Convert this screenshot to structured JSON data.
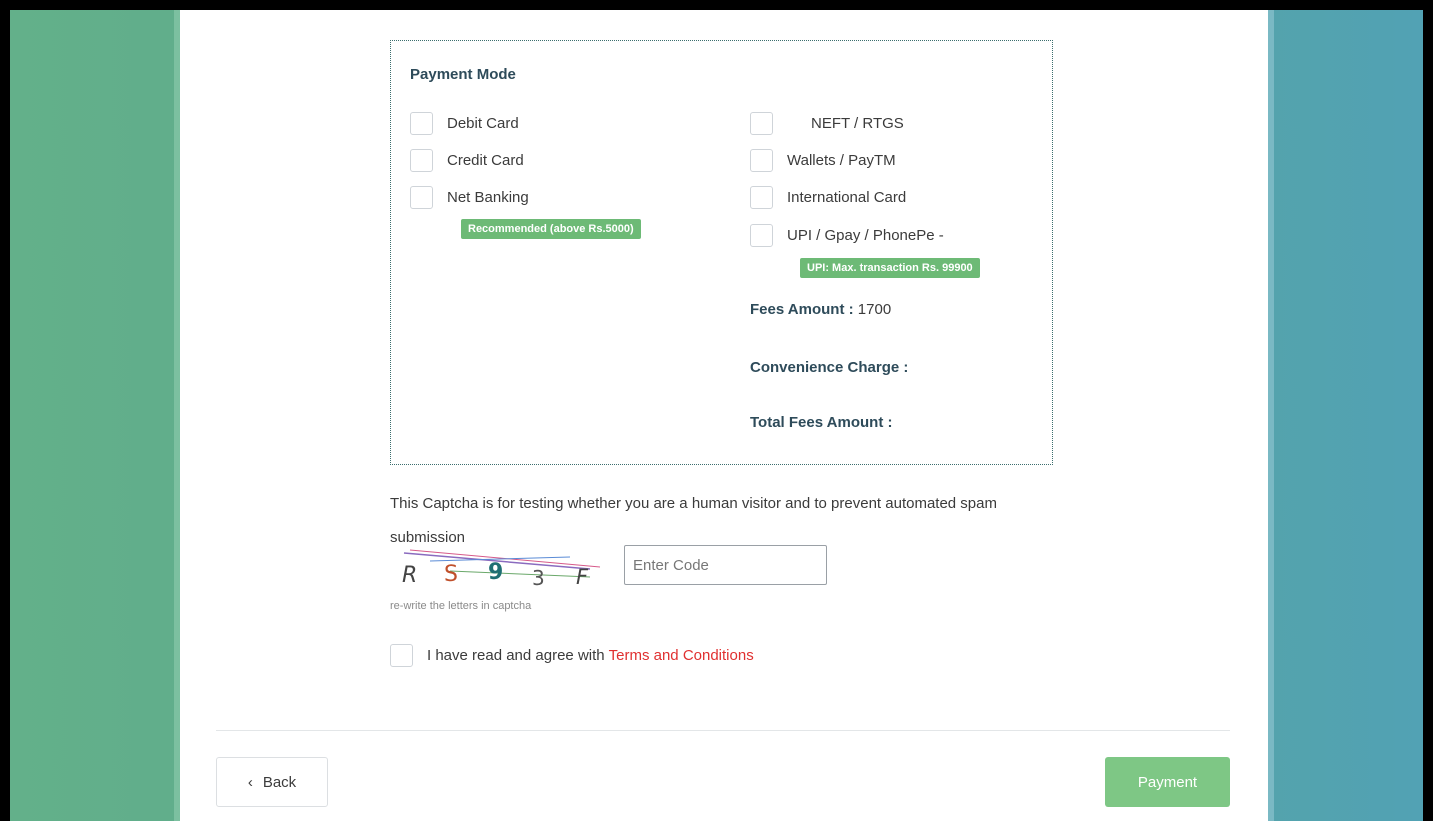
{
  "payment_mode": {
    "title": "Payment Mode",
    "left_options": [
      {
        "label": "Debit Card",
        "checked": false
      },
      {
        "label": "Credit Card",
        "checked": false
      },
      {
        "label": "Net Banking",
        "checked": false
      }
    ],
    "right_options": [
      {
        "label": "NEFT / RTGS",
        "checked": false
      },
      {
        "label": "Wallets / PayTM",
        "checked": false
      },
      {
        "label": "International Card",
        "checked": false
      },
      {
        "label": "UPI / Gpay / PhonePe -",
        "checked": false
      }
    ],
    "net_banking_badge": "Recommended (above Rs.5000)",
    "upi_badge": "UPI: Max. transaction Rs. 99900"
  },
  "fees": {
    "fees_amount_label": "Fees Amount :",
    "fees_amount_value": " 1700",
    "convenience_label": "Convenience Charge :",
    "convenience_value": "",
    "total_label": "Total Fees Amount :",
    "total_value": ""
  },
  "captcha": {
    "description": "This Captcha is for testing whether you are a human visitor and to prevent automated spam submission",
    "letters": [
      "R",
      "S",
      "9",
      "3",
      "F"
    ],
    "input_placeholder": "Enter Code",
    "input_value": "",
    "hint": "re-write the letters in captcha"
  },
  "agreement": {
    "text": "I have read and agree with",
    "link": "Terms and Conditions",
    "checked": false
  },
  "footer": {
    "back_icon": "chevron-left-icon",
    "back_label": "Back",
    "payment_label": "Payment"
  },
  "colors": {
    "badge_green": "#6dba76",
    "payment_button": "#7ec785",
    "terms_link": "#e03030"
  }
}
